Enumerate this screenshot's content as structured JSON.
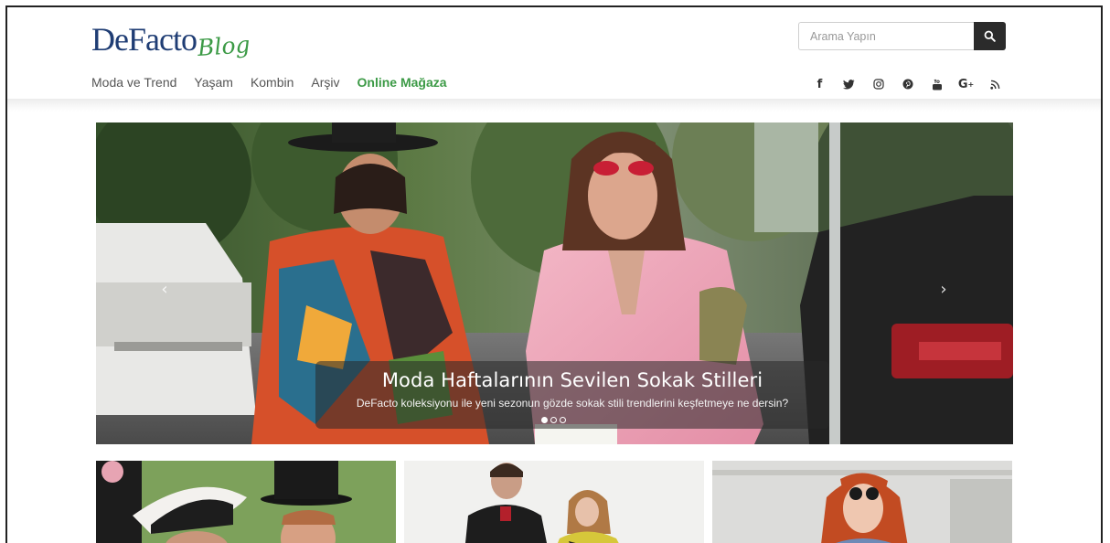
{
  "brand": {
    "name_main": "DeFacto",
    "name_script": "Blog",
    "main_color": "#1f3d74",
    "script_color": "#3c9a46"
  },
  "nav": {
    "items": [
      {
        "label": "Moda ve Trend"
      },
      {
        "label": "Yaşam"
      },
      {
        "label": "Kombin"
      },
      {
        "label": "Arşiv"
      },
      {
        "label": "Online Mağaza",
        "highlight": true
      }
    ]
  },
  "search": {
    "placeholder": "Arama Yapın",
    "button_icon": "search-icon"
  },
  "social": {
    "icons": [
      "facebook-icon",
      "twitter-icon",
      "instagram-icon",
      "pinterest-icon",
      "youtube-icon",
      "google-plus-icon",
      "rss-icon"
    ]
  },
  "hero": {
    "title": "Moda Haftalarının Sevilen Sokak Stilleri",
    "subtitle": "DeFacto koleksiyonu ile yeni sezonun gözde sokak stili trendlerini keşfetmeye ne dersin?",
    "slide_count": 3,
    "active_slide": 1,
    "prev_icon": "chevron-left-icon",
    "next_icon": "chevron-right-icon"
  },
  "cards": [
    {
      "image": "card-image-royals-hats"
    },
    {
      "image": "card-image-couple-studio"
    },
    {
      "image": "card-image-redhead-street"
    }
  ],
  "colors": {
    "accent": "#3c9a46",
    "search_button": "#2b2b2b"
  }
}
